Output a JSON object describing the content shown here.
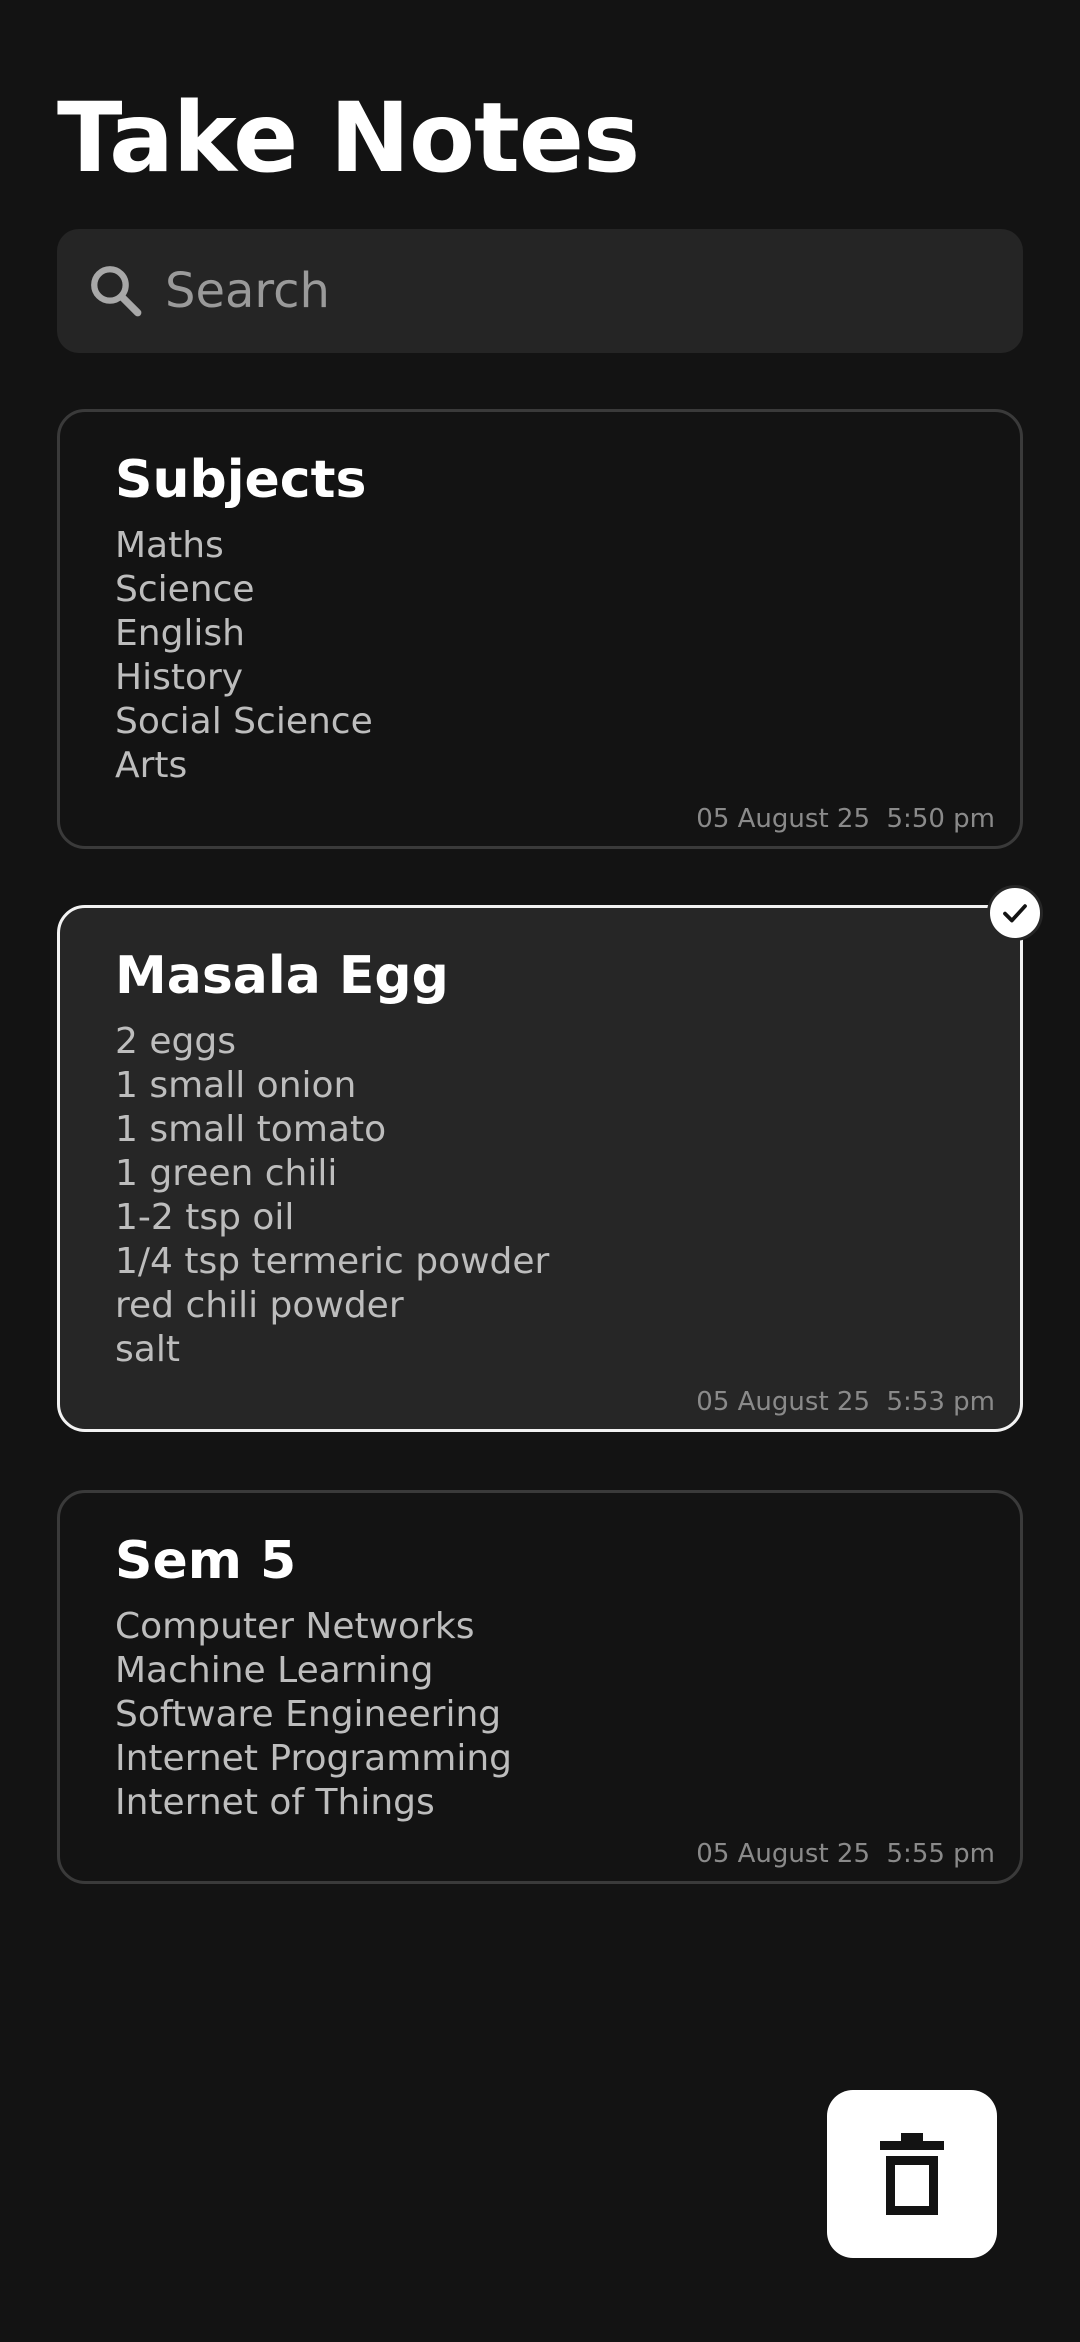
{
  "header": {
    "title": "Take Notes"
  },
  "search": {
    "placeholder": "Search",
    "icon": "search-icon"
  },
  "notes": [
    {
      "title": "Subjects",
      "lines": [
        "Maths",
        "Science",
        "English",
        "History",
        "Social Science",
        "Arts"
      ],
      "date": "05 August 25",
      "time": "5:50 pm",
      "selected": false
    },
    {
      "title": "Masala Egg",
      "lines": [
        "2 eggs",
        "1 small onion",
        "1 small tomato",
        "1 green chili",
        "1-2 tsp oil",
        "1/4 tsp termeric powder",
        "red chili powder",
        "salt"
      ],
      "date": "05 August 25",
      "time": "5:53 pm",
      "selected": true
    },
    {
      "title": "Sem 5",
      "lines": [
        "Computer Networks",
        "Machine Learning",
        "Software Engineering",
        "Internet Programming",
        "Internet of Things"
      ],
      "date": "05 August 25",
      "time": "5:55 pm",
      "selected": false
    }
  ],
  "actions": {
    "delete_icon": "trash-icon",
    "selected_icon": "checkmark-icon"
  },
  "colors": {
    "background": "#131313",
    "card_selected": "#262626",
    "text_primary": "#ffffff",
    "text_secondary": "#bdbdbd",
    "accent": "#ffffff"
  }
}
